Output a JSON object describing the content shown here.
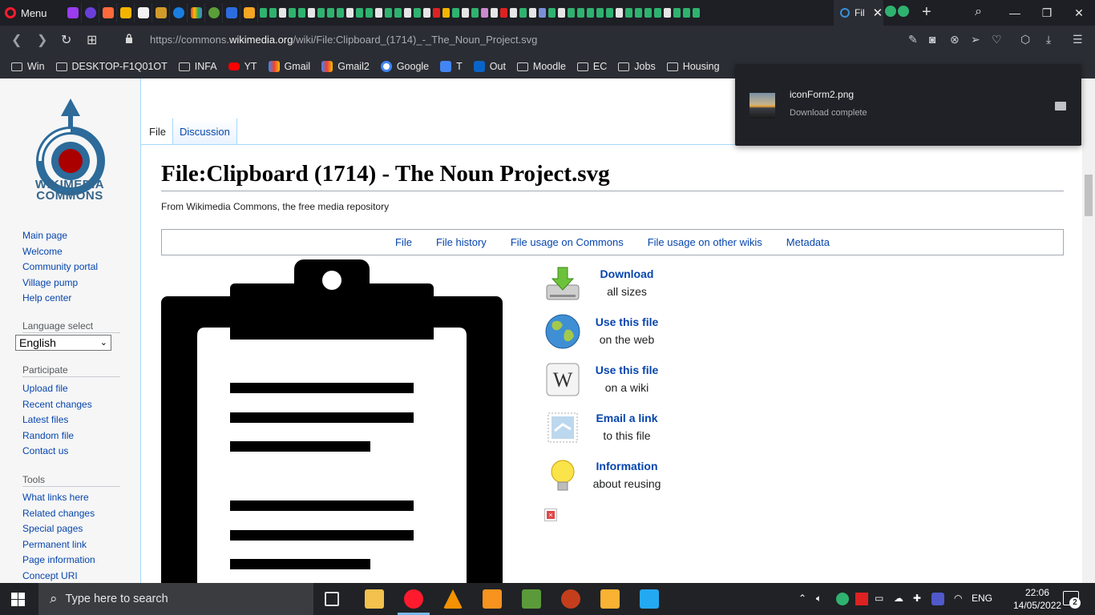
{
  "browser": {
    "menu_label": "Menu",
    "active_tab_label": "Fil",
    "url_prefix": "https://commons.",
    "url_domain": "wikimedia.org",
    "url_path": "/wiki/File:Clipboard_(1714)_-_The_Noun_Project.svg",
    "accent": "#ff1b2d"
  },
  "bookmarks": [
    {
      "label": "Win",
      "icon": "folder-icon"
    },
    {
      "label": "DESKTOP-F1Q01OT",
      "icon": "folder-icon"
    },
    {
      "label": "INFA",
      "icon": "folder-icon"
    },
    {
      "label": "YT",
      "icon": "youtube-icon"
    },
    {
      "label": "Gmail",
      "icon": "gmail-icon"
    },
    {
      "label": "Gmail2",
      "icon": "gmail-icon"
    },
    {
      "label": "Google",
      "icon": "google-icon"
    },
    {
      "label": "T",
      "icon": "translate-icon"
    },
    {
      "label": "Out",
      "icon": "outlook-icon"
    },
    {
      "label": "Moodle",
      "icon": "folder-icon"
    },
    {
      "label": "EC",
      "icon": "folder-icon"
    },
    {
      "label": "Jobs",
      "icon": "folder-icon"
    },
    {
      "label": "Housing",
      "icon": "folder-icon"
    }
  ],
  "download": {
    "filename": "iconForm2.png",
    "status": "Download complete"
  },
  "sidebar": {
    "logo_line1": "WIKIMEDIA",
    "logo_line2": "COMMONS",
    "main_links": [
      "Main page",
      "Welcome",
      "Community portal",
      "Village pump",
      "Help center"
    ],
    "language_heading": "Language select",
    "language_value": "English",
    "participate_heading": "Participate",
    "participate_links": [
      "Upload file",
      "Recent changes",
      "Latest files",
      "Random file",
      "Contact us"
    ],
    "tools_heading": "Tools",
    "tools_links": [
      "What links here",
      "Related changes",
      "Special pages",
      "Permanent link",
      "Page information",
      "Concept URI"
    ]
  },
  "page": {
    "tab_file": "File",
    "tab_discussion": "Discussion",
    "title": "File:Clipboard (1714) - The Noun Project.svg",
    "subtitle": "From Wikimedia Commons, the free media repository",
    "toc": [
      "File",
      "File history",
      "File usage on Commons",
      "File usage on other wikis",
      "Metadata"
    ],
    "actions": [
      {
        "title": "Download",
        "sub": "all sizes",
        "icon": "download-icon"
      },
      {
        "title": "Use this file",
        "sub": "on the web",
        "icon": "globe-icon"
      },
      {
        "title": "Use this file",
        "sub": "on a wiki",
        "icon": "wikipedia-icon"
      },
      {
        "title": "Email a link",
        "sub": "to this file",
        "icon": "email-icon"
      },
      {
        "title": "Information",
        "sub": "about reusing",
        "icon": "lightbulb-icon"
      }
    ]
  },
  "taskbar": {
    "search_placeholder": "Type here to search",
    "language": "ENG",
    "time": "22:06",
    "date": "14/05/2022",
    "notification_count": "2"
  }
}
